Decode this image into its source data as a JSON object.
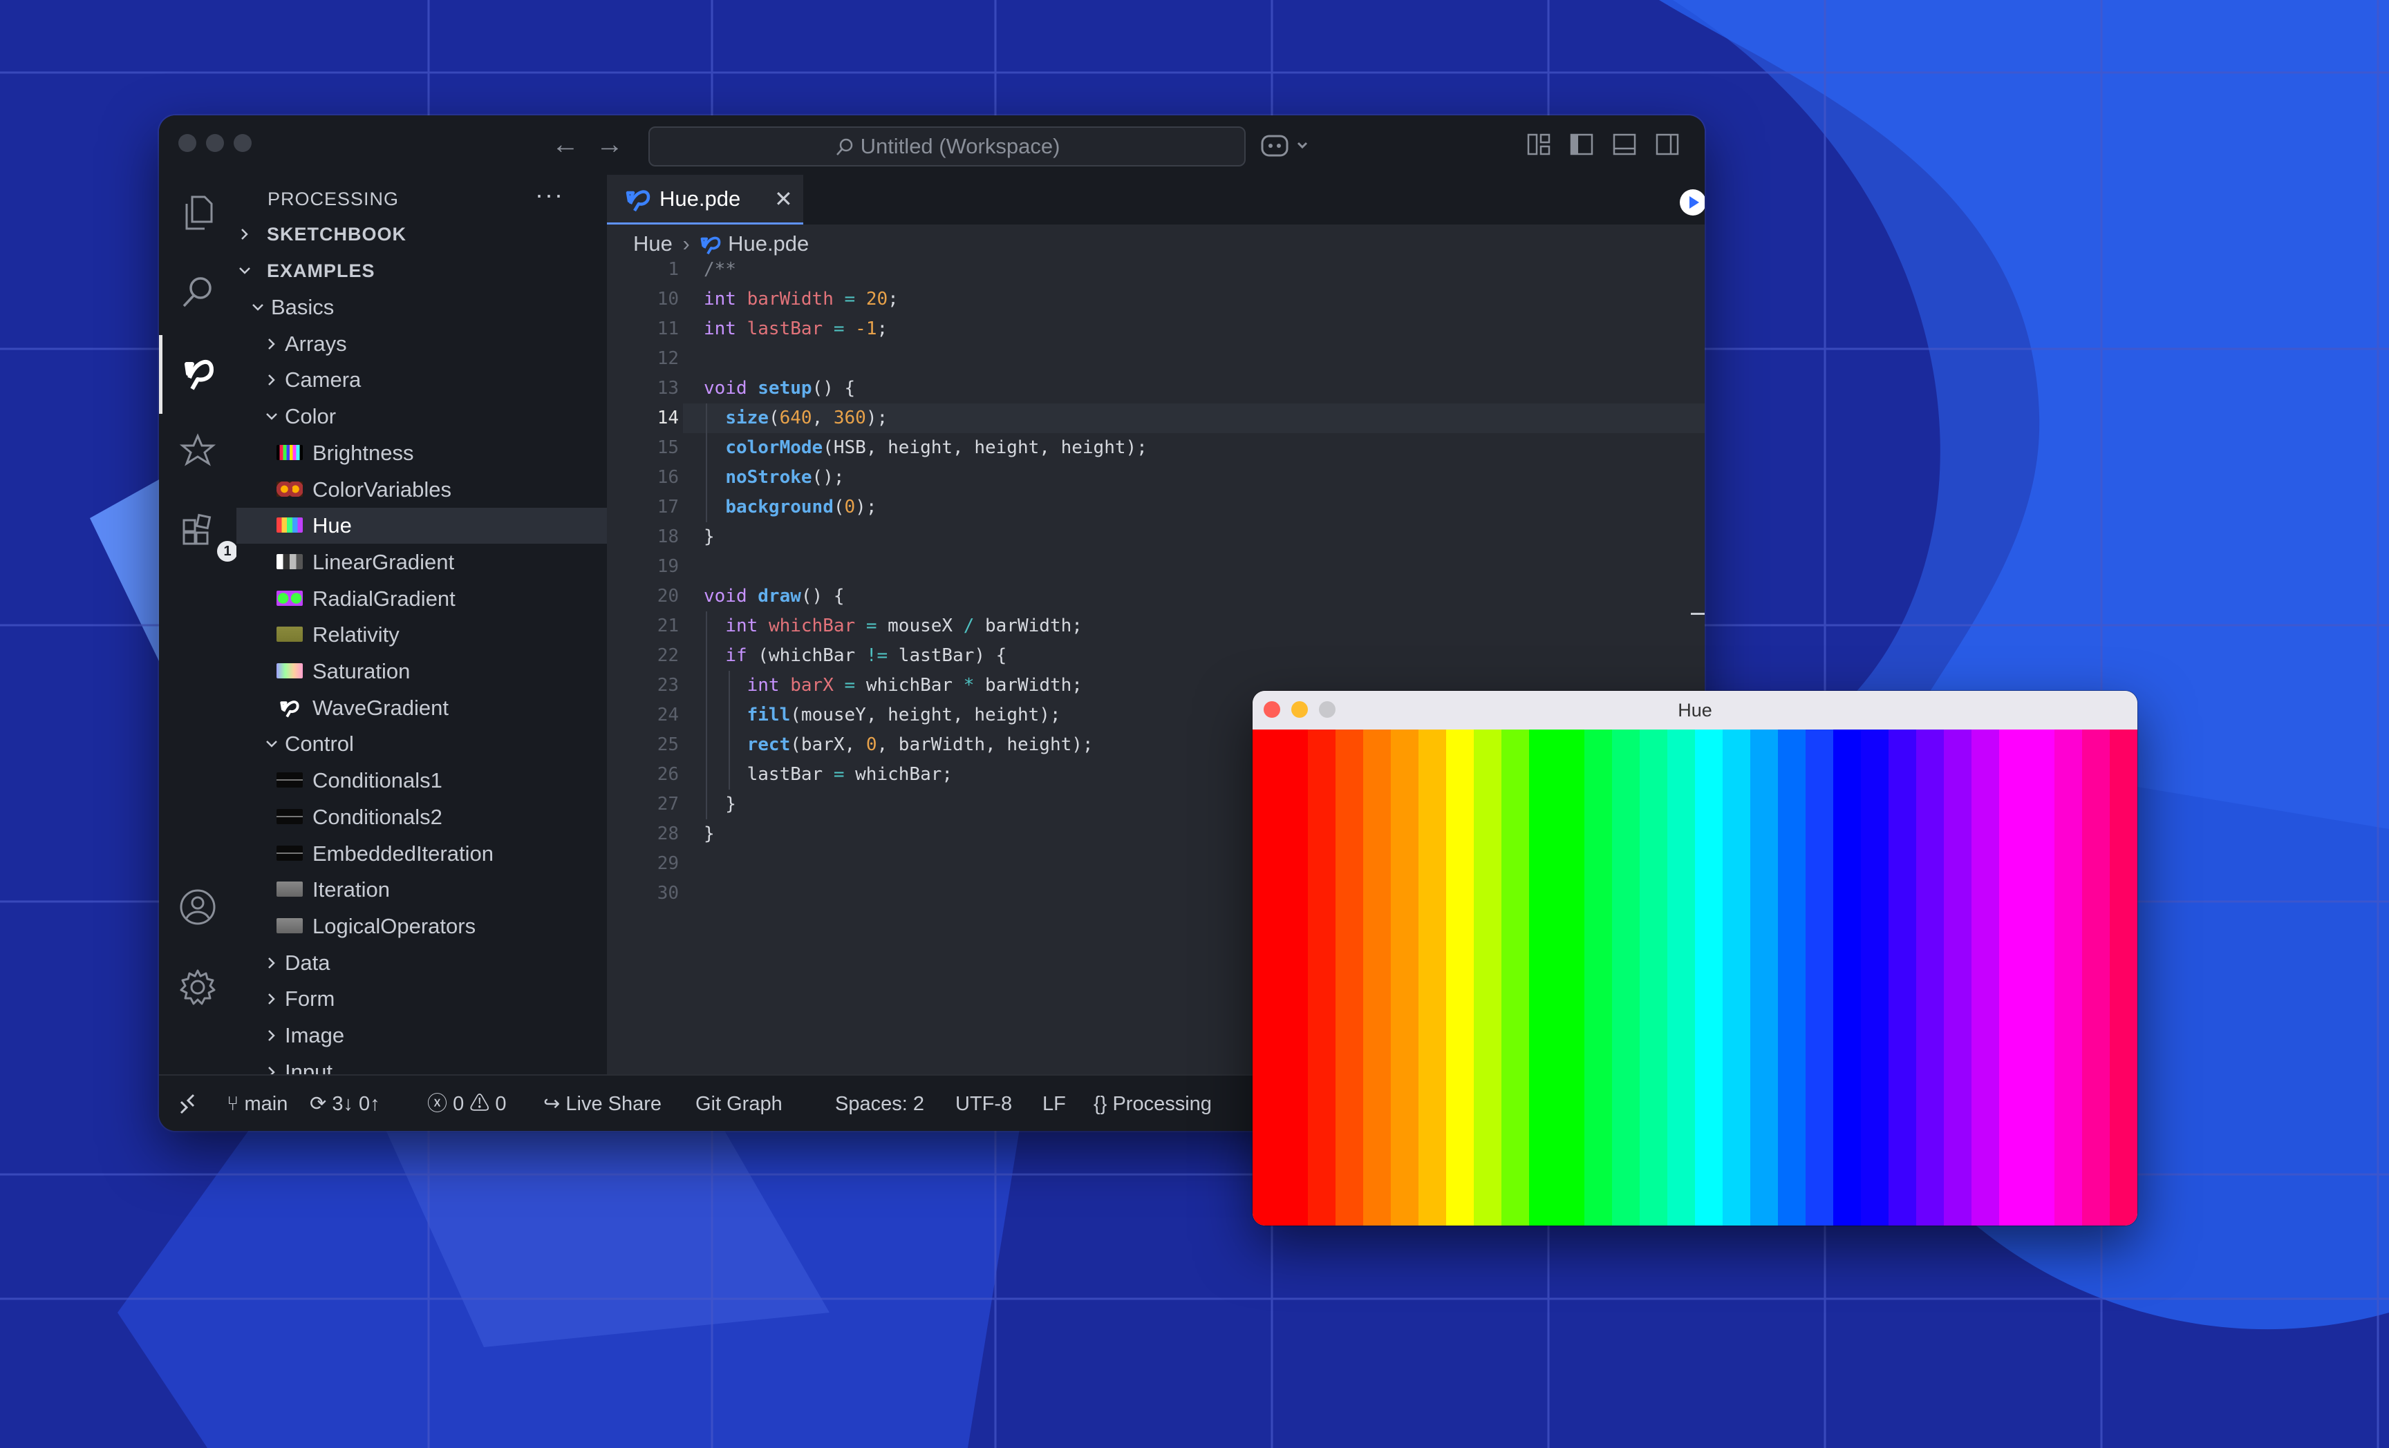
{
  "window": {
    "search_text": "Untitled (Workspace)",
    "nav_back": "←",
    "nav_forward": "→"
  },
  "activity_bar": {
    "items": [
      "explorer-icon",
      "search-icon",
      "processing-icon",
      "extensions-icon",
      "remote-explorer-icon"
    ],
    "badge": "1",
    "bottom": [
      "account-icon",
      "manage-gear-icon"
    ]
  },
  "sidebar": {
    "title": "PROCESSING",
    "more": "···",
    "sections": [
      {
        "label": "SKETCHBOOK",
        "expanded": false
      },
      {
        "label": "EXAMPLES",
        "expanded": true
      }
    ],
    "tree": [
      {
        "label": "Basics",
        "level": 1,
        "kind": "folder-open"
      },
      {
        "label": "Arrays",
        "level": 2,
        "kind": "folder"
      },
      {
        "label": "Camera",
        "level": 2,
        "kind": "folder"
      },
      {
        "label": "Color",
        "level": 2,
        "kind": "folder-open"
      },
      {
        "label": "Brightness",
        "level": 3,
        "kind": "sketch",
        "thumb": "brightness"
      },
      {
        "label": "ColorVariables",
        "level": 3,
        "kind": "sketch",
        "thumb": "colorvariables"
      },
      {
        "label": "Hue",
        "level": 3,
        "kind": "sketch",
        "thumb": "hue",
        "selected": true
      },
      {
        "label": "LinearGradient",
        "level": 3,
        "kind": "sketch",
        "thumb": "lineargradient"
      },
      {
        "label": "RadialGradient",
        "level": 3,
        "kind": "sketch",
        "thumb": "radialgradient"
      },
      {
        "label": "Relativity",
        "level": 3,
        "kind": "sketch",
        "thumb": "relativity"
      },
      {
        "label": "Saturation",
        "level": 3,
        "kind": "sketch",
        "thumb": "saturation"
      },
      {
        "label": "WaveGradient",
        "level": 3,
        "kind": "sketch",
        "thumb": "processing"
      },
      {
        "label": "Control",
        "level": 2,
        "kind": "folder-open"
      },
      {
        "label": "Conditionals1",
        "level": 3,
        "kind": "sketch",
        "thumb": "dark"
      },
      {
        "label": "Conditionals2",
        "level": 3,
        "kind": "sketch",
        "thumb": "dark"
      },
      {
        "label": "EmbeddedIteration",
        "level": 3,
        "kind": "sketch",
        "thumb": "dark"
      },
      {
        "label": "Iteration",
        "level": 3,
        "kind": "sketch",
        "thumb": "grey"
      },
      {
        "label": "LogicalOperators",
        "level": 3,
        "kind": "sketch",
        "thumb": "grey"
      },
      {
        "label": "Data",
        "level": 2,
        "kind": "folder"
      },
      {
        "label": "Form",
        "level": 2,
        "kind": "folder"
      },
      {
        "label": "Image",
        "level": 2,
        "kind": "folder"
      },
      {
        "label": "Input",
        "level": 2,
        "kind": "folder"
      }
    ]
  },
  "editor": {
    "tab": {
      "label": "Hue.pde",
      "close": "✕"
    },
    "breadcrumb": {
      "folder": "Hue",
      "file": "Hue.pde"
    },
    "current_line": "14",
    "lines": [
      {
        "num": "1",
        "tokens": [
          [
            "cm",
            "/**"
          ]
        ]
      },
      {
        "num": "10",
        "tokens": [
          [
            "k",
            "int "
          ],
          [
            "v",
            "barWidth"
          ],
          [
            "op",
            " = "
          ],
          [
            "n",
            "20"
          ],
          [
            "p",
            ";"
          ]
        ]
      },
      {
        "num": "11",
        "tokens": [
          [
            "k",
            "int "
          ],
          [
            "v",
            "lastBar"
          ],
          [
            "op",
            " = "
          ],
          [
            "n",
            "-1"
          ],
          [
            "p",
            ";"
          ]
        ]
      },
      {
        "num": "12",
        "tokens": []
      },
      {
        "num": "13",
        "tokens": [
          [
            "k",
            "void "
          ],
          [
            "fn",
            "setup"
          ],
          [
            "p",
            "() {"
          ]
        ]
      },
      {
        "num": "14",
        "tokens": [
          [
            "p",
            "  "
          ],
          [
            "fn",
            "size"
          ],
          [
            "p",
            "("
          ],
          [
            "n",
            "640"
          ],
          [
            "p",
            ", "
          ],
          [
            "n",
            "360"
          ],
          [
            "p",
            ");"
          ]
        ]
      },
      {
        "num": "15",
        "tokens": [
          [
            "p",
            "  "
          ],
          [
            "fn",
            "colorMode"
          ],
          [
            "p",
            "(HSB, height, height, height);"
          ]
        ]
      },
      {
        "num": "16",
        "tokens": [
          [
            "p",
            "  "
          ],
          [
            "fn",
            "noStroke"
          ],
          [
            "p",
            "();"
          ]
        ]
      },
      {
        "num": "17",
        "tokens": [
          [
            "p",
            "  "
          ],
          [
            "fn",
            "background"
          ],
          [
            "p",
            "("
          ],
          [
            "n",
            "0"
          ],
          [
            "p",
            ");"
          ]
        ]
      },
      {
        "num": "18",
        "tokens": [
          [
            "p",
            "}"
          ]
        ]
      },
      {
        "num": "19",
        "tokens": []
      },
      {
        "num": "20",
        "tokens": [
          [
            "k",
            "void "
          ],
          [
            "fn",
            "draw"
          ],
          [
            "p",
            "() {"
          ]
        ]
      },
      {
        "num": "21",
        "tokens": [
          [
            "p",
            "  "
          ],
          [
            "k",
            "int "
          ],
          [
            "v",
            "whichBar"
          ],
          [
            "op",
            " = "
          ],
          [
            "p",
            "mouseX "
          ],
          [
            "op",
            "/ "
          ],
          [
            "p",
            "barWidth;"
          ]
        ]
      },
      {
        "num": "22",
        "tokens": [
          [
            "p",
            "  "
          ],
          [
            "k",
            "if "
          ],
          [
            "p",
            "(whichBar "
          ],
          [
            "op",
            "!= "
          ],
          [
            "p",
            "lastBar) {"
          ]
        ]
      },
      {
        "num": "23",
        "tokens": [
          [
            "p",
            "    "
          ],
          [
            "k",
            "int "
          ],
          [
            "v",
            "barX"
          ],
          [
            "op",
            " = "
          ],
          [
            "p",
            "whichBar "
          ],
          [
            "op",
            "* "
          ],
          [
            "p",
            "barWidth;"
          ]
        ]
      },
      {
        "num": "24",
        "tokens": [
          [
            "p",
            "    "
          ],
          [
            "fn",
            "fill"
          ],
          [
            "p",
            "(mouseY, height, height);"
          ]
        ]
      },
      {
        "num": "25",
        "tokens": [
          [
            "p",
            "    "
          ],
          [
            "fn",
            "rect"
          ],
          [
            "p",
            "(barX, "
          ],
          [
            "n",
            "0"
          ],
          [
            "p",
            ", barWidth, height);"
          ]
        ]
      },
      {
        "num": "26",
        "tokens": [
          [
            "p",
            "    lastBar "
          ],
          [
            "op",
            "= "
          ],
          [
            "p",
            "whichBar;"
          ]
        ]
      },
      {
        "num": "27",
        "tokens": [
          [
            "p",
            "  }"
          ]
        ]
      },
      {
        "num": "28",
        "tokens": [
          [
            "p",
            "}"
          ]
        ]
      },
      {
        "num": "29",
        "tokens": []
      },
      {
        "num": "30",
        "tokens": []
      }
    ]
  },
  "statusbar": {
    "branch": "main",
    "sync": "3↓ 0↑",
    "errors": "0",
    "warnings": "0",
    "live_share": "Live Share",
    "git_graph": "Git Graph",
    "spaces": "Spaces: 2",
    "encoding": "UTF-8",
    "eol": "LF",
    "language": "Processing"
  },
  "sketch_window": {
    "title": "Hue",
    "bars": [
      "#ff0000",
      "#ff0000",
      "#ff1d00",
      "#ff4d00",
      "#ff7a00",
      "#ff9a00",
      "#ffc000",
      "#ffff00",
      "#bbff00",
      "#70ff00",
      "#00ff00",
      "#00ff00",
      "#00ff40",
      "#00ff70",
      "#00ff99",
      "#00ffc4",
      "#00ffff",
      "#00d8ff",
      "#00a6ff",
      "#006dff",
      "#1440ff",
      "#0000ff",
      "#0f00ff",
      "#3c00ff",
      "#6a00ff",
      "#9900ff",
      "#c700ff",
      "#ff00ff",
      "#ff00ff",
      "#ff00d2",
      "#ff0099",
      "#ff0063"
    ]
  },
  "colors": {
    "background": "#1b2a9c",
    "editor_bg": "#262930",
    "chrome_bg": "#181b21",
    "accent": "#5f93ff"
  }
}
